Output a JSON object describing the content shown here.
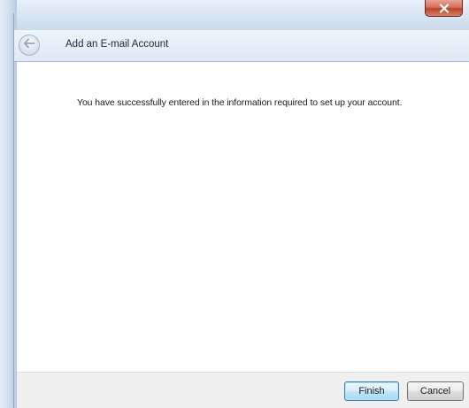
{
  "window": {
    "close_icon": "close-x-icon"
  },
  "header": {
    "back_icon": "back-arrow-icon",
    "title": "Add an E-mail Account"
  },
  "main": {
    "message": "You have successfully entered in the information required to set up your account."
  },
  "footer": {
    "finish_label": "Finish",
    "cancel_label": "Cancel"
  },
  "colors": {
    "close_button": "#c0422a",
    "default_button_border": "#3c7fb1",
    "content_background": "#ffffff",
    "footer_background": "#f0f0f0"
  }
}
